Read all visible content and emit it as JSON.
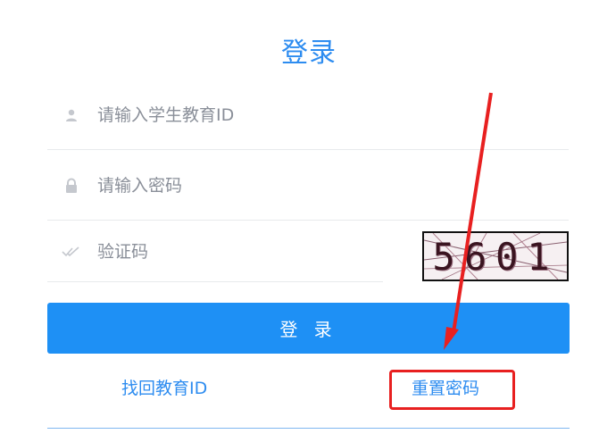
{
  "title": "登录",
  "username": {
    "placeholder": "请输入学生教育ID",
    "icon": "user-icon"
  },
  "password": {
    "placeholder": "请输入密码",
    "icon": "lock-icon"
  },
  "captcha": {
    "placeholder": "验证码",
    "icon": "check-icon",
    "image_text": "5601"
  },
  "login_button": "登 录",
  "links": {
    "find_id": "找回教育ID",
    "reset_password": "重置密码"
  },
  "colors": {
    "accent": "#2d8cf0",
    "button": "#1e90f5",
    "annotation": "#e82020"
  }
}
